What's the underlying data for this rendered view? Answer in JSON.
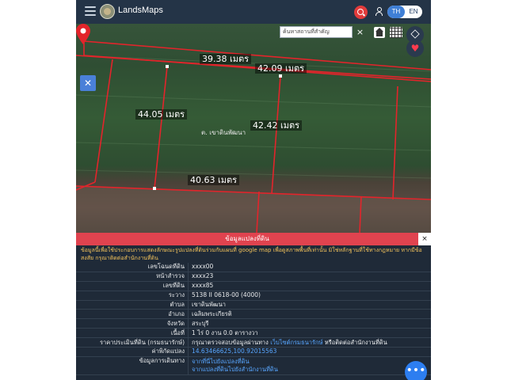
{
  "header": {
    "brand": "LandsMaps",
    "lang_th": "TH",
    "lang_en": "EN"
  },
  "map": {
    "search_placeholder": "ค้นหาสถานที่สำคัญ",
    "clear": "×",
    "heart": "♥",
    "measure": "✕",
    "measurements": [
      "39.38 เมตร",
      "42.09 เมตร",
      "44.05 เมตร",
      "42.42 เมตร",
      "40.63 เมตร"
    ],
    "parcel_label": "ต. เขาดินพัฒนา"
  },
  "panel": {
    "title": "ข้อมูลแปลงที่ดิน",
    "close": "×",
    "notice": "ข้อมูลนี้เพื่อใช้ประกอบการแสดงลักษณะรูปแปลงที่ดินร่วมกับแผนที่ google map เพื่อดูสภาพพื้นที่เท่านั้น มิใช่หลักฐานที่ใช้ทางกฎหมาย หากมีข้อสงสัย กรุณาติดต่อสำนักงานที่ดิน",
    "rows": [
      {
        "key": "เลขโฉนดที่ดิน",
        "value": "xxxx00"
      },
      {
        "key": "หน้าสำรวจ",
        "value": "xxxx23"
      },
      {
        "key": "เลขที่ดิน",
        "value": "xxxx85"
      },
      {
        "key": "ระวาง",
        "value": "5138 II 0618-00 (4000)"
      },
      {
        "key": "ตำบล",
        "value": "เขาดินพัฒนา"
      },
      {
        "key": "อำเภอ",
        "value": "เฉลิมพระเกียรติ"
      },
      {
        "key": "จังหวัด",
        "value": "สระบุรี"
      },
      {
        "key": "เนื้อที่",
        "value": "1 ไร่ 0 งาน 0.0 ตารางวา"
      },
      {
        "key": "ราคาประเมินที่ดิน (กรมธนารักษ์)",
        "value_pre": "กรุณาตรวจสอบข้อมูลผ่านทาง ",
        "value_link": "เว็บไซต์กรมธนารักษ์",
        "value_post": " หรือติดต่อสำนักงานที่ดิน"
      },
      {
        "key": "ค่าพิกัดแปลง",
        "value_link": "14.63466625,100.92015563"
      },
      {
        "key": "ข้อมูลการเดินทาง",
        "value_link": "จากที่นี่ไปยังแปลงที่ดิน",
        "value_link2": "จากแปลงที่ดินไปยังสำนักงานที่ดิน"
      }
    ]
  },
  "fab": "•••"
}
